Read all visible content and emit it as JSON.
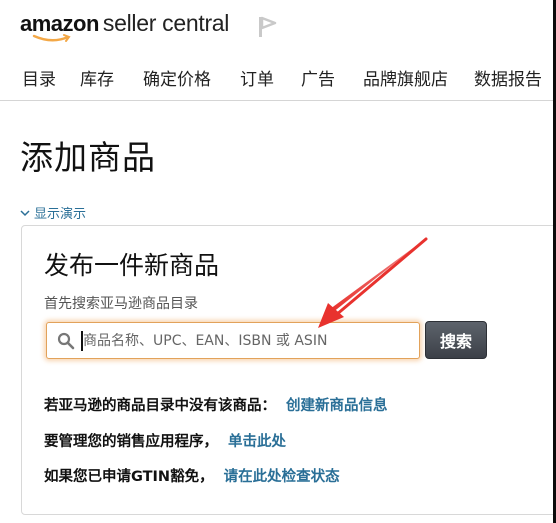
{
  "header": {
    "logo_brand": "amazon",
    "logo_sub": "seller central",
    "flag_icon": "flag-icon"
  },
  "nav": {
    "items": [
      {
        "label": "目录"
      },
      {
        "label": "库存"
      },
      {
        "label": "确定价格"
      },
      {
        "label": "订单"
      },
      {
        "label": "广告"
      },
      {
        "label": "品牌旗舰店"
      },
      {
        "label": "数据报告"
      }
    ]
  },
  "page": {
    "title": "添加商品",
    "demo_toggle": "显示演示"
  },
  "card": {
    "title": "发布一件新商品",
    "subtitle": "首先搜索亚马逊商品目录",
    "search": {
      "placeholder": "商品名称、UPC、EAN、ISBN 或 ASIN",
      "value": "",
      "button_label": "搜索"
    },
    "lines": [
      {
        "text": "若亚马逊的商品目录中没有该商品：",
        "link": "创建新商品信息"
      },
      {
        "text": "要管理您的销售应用程序，",
        "link": "单击此处"
      },
      {
        "text": "如果您已申请GTIN豁免，",
        "link": "请在此处检查状态"
      }
    ]
  },
  "colors": {
    "link": "#2a6f97",
    "search_focus": "#e2a25a",
    "button_bg": "#4a4f57",
    "annotation_arrow": "#e8322e",
    "logo_smile": "#f3a847"
  }
}
